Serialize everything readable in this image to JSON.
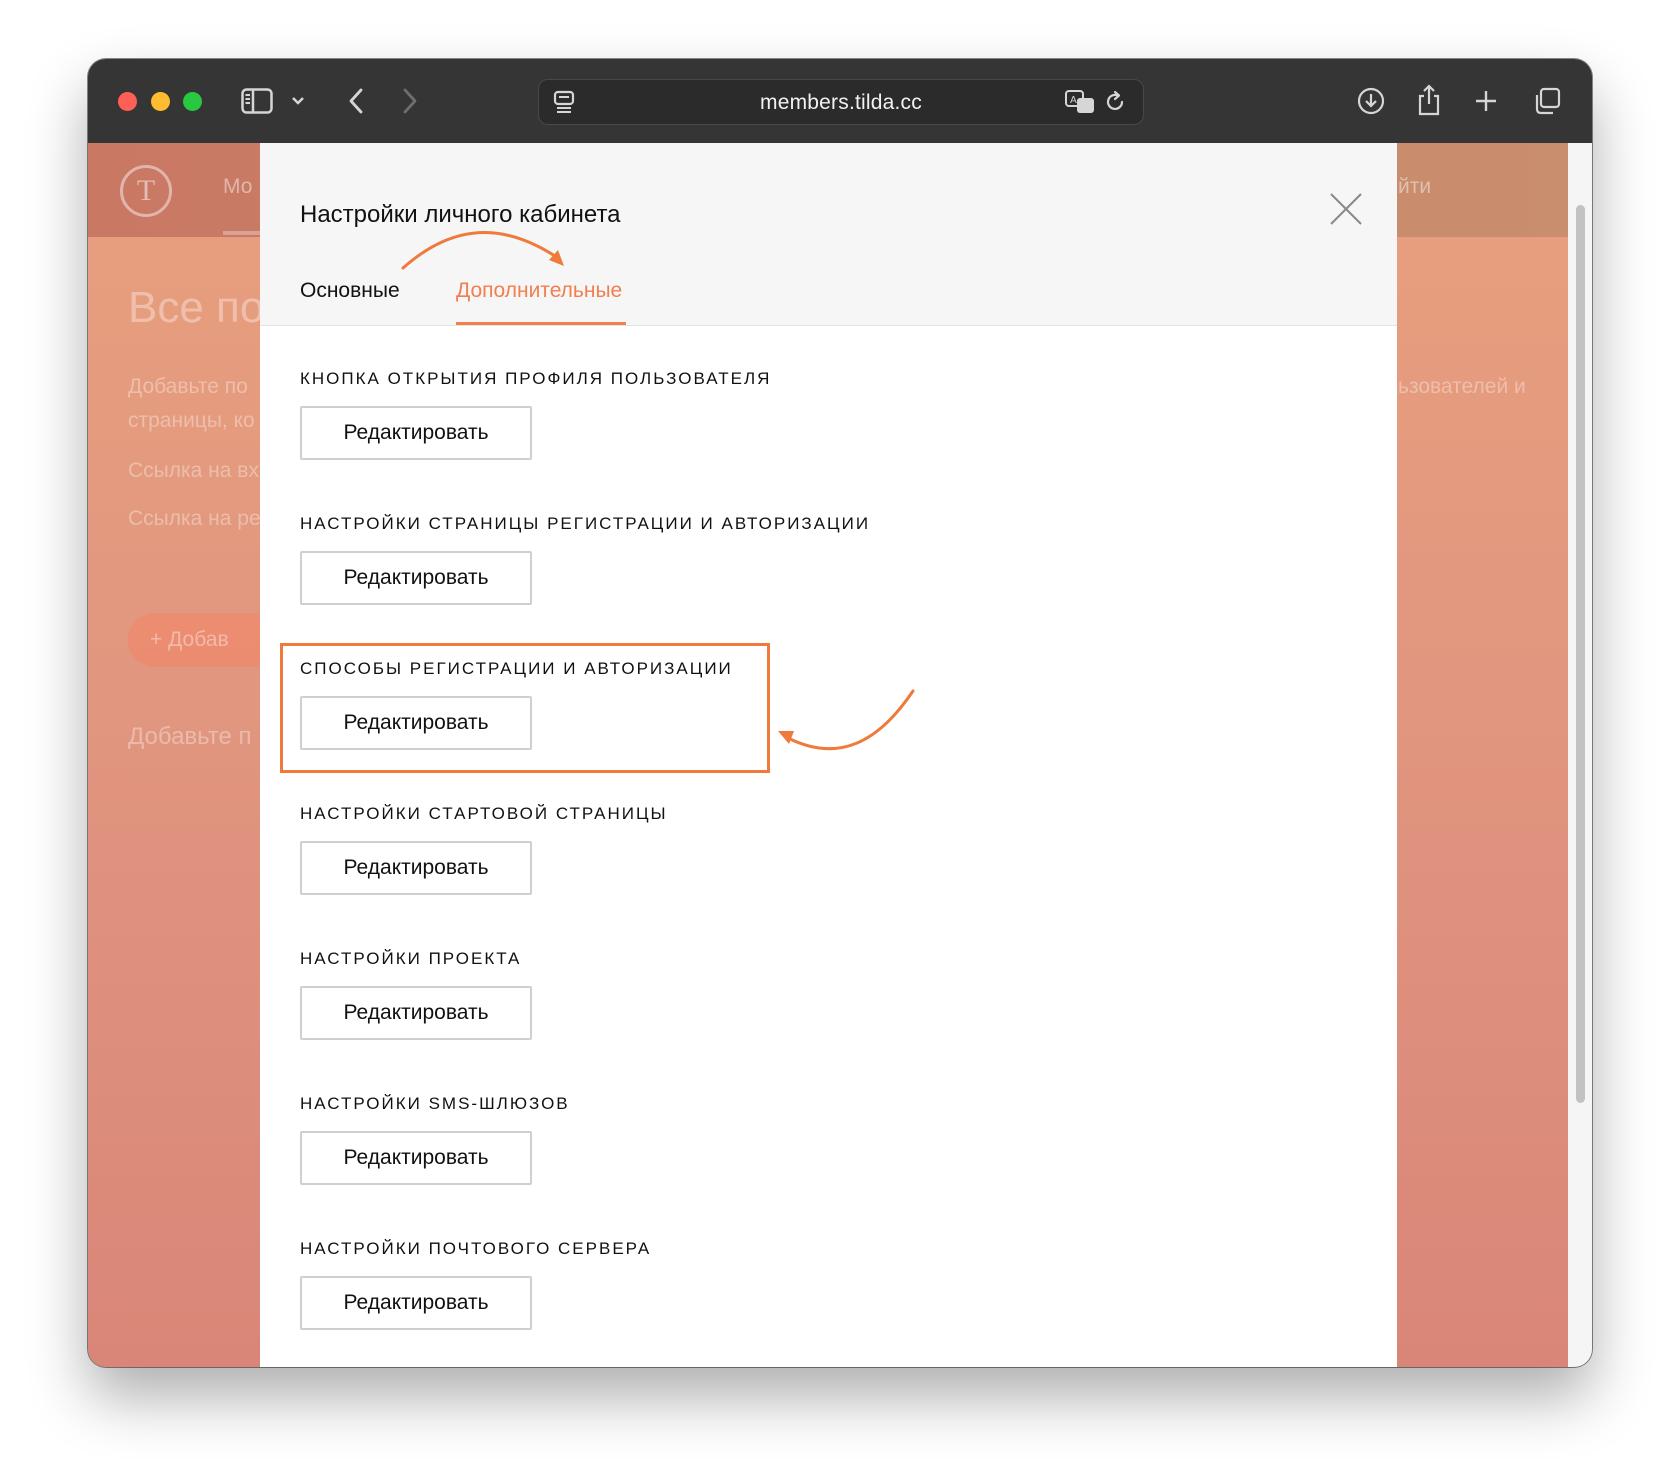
{
  "browser": {
    "url": "members.tilda.cc",
    "icons": [
      "sidebar-icon",
      "chevron-down-icon",
      "back-icon",
      "forward-icon",
      "page-menu-icon",
      "translate-icon",
      "reload-icon",
      "download-icon",
      "share-icon",
      "new-tab-icon",
      "tabs-overview-icon"
    ]
  },
  "background": {
    "logo": "T",
    "nav_left": "Мо",
    "nav_right": "йти",
    "title": "Все по",
    "lines": [
      "Добавьте по",
      "страницы, ко",
      "Ссылка на вх",
      "Ссылка на ре"
    ],
    "right_line": "ьзователей и",
    "add_button": "+ Добав",
    "subtitle": "Добавьте п"
  },
  "modal": {
    "title": "Настройки личного кабинета",
    "tabs": [
      {
        "label": "Основные",
        "active": false
      },
      {
        "label": "Дополнительные",
        "active": true
      }
    ],
    "sections": [
      {
        "label": "КНОПКА ОТКРЫТИЯ ПРОФИЛЯ ПОЛЬЗОВАТЕЛЯ",
        "button": "Редактировать"
      },
      {
        "label": "НАСТРОЙКИ СТРАНИЦЫ РЕГИСТРАЦИИ И АВТОРИЗАЦИИ",
        "button": "Редактировать"
      },
      {
        "label": "СПОСОБЫ РЕГИСТРАЦИИ И АВТОРИЗАЦИИ",
        "button": "Редактировать",
        "highlighted": true
      },
      {
        "label": "НАСТРОЙКИ СТАРТОВОЙ СТРАНИЦЫ",
        "button": "Редактировать"
      },
      {
        "label": "НАСТРОЙКИ ПРОЕКТА",
        "button": "Редактировать"
      },
      {
        "label": "НАСТРОЙКИ SMS-ШЛЮЗОВ",
        "button": "Редактировать"
      },
      {
        "label": "НАСТРОЙКИ ПОЧТОВОГО СЕРВЕРА",
        "button": "Редактировать"
      }
    ]
  },
  "colors": {
    "accent": "#f17f50",
    "annotation": "#ee7a3c",
    "toolbar": "#353535"
  }
}
